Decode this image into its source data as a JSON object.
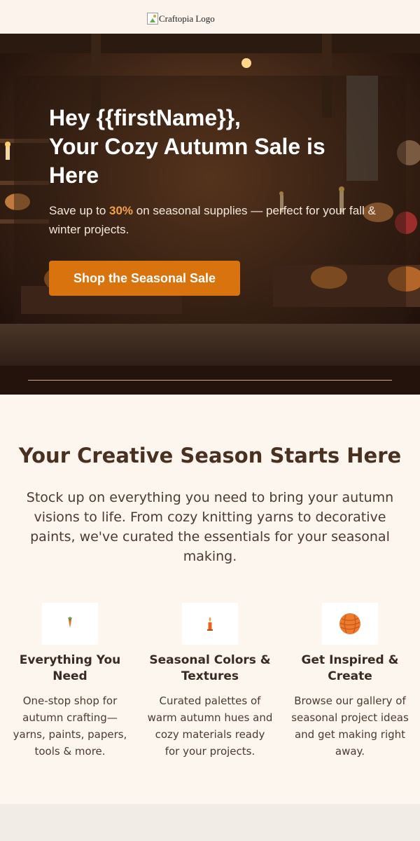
{
  "header": {
    "logo_alt": "Craftopia Logo"
  },
  "hero": {
    "title_line1": "Hey {{firstName}},",
    "title_line2": "Your Cozy Autumn Sale is Here",
    "sub_before": "Save up to ",
    "sub_percent": "30%",
    "sub_after": " on seasonal supplies — perfect for your fall & winter projects.",
    "cta_label": "Shop the Seasonal Sale"
  },
  "intro": {
    "title": "Your Creative Season Starts Here",
    "description": "Stock up on everything you need to bring your autumn visions to life. From cozy knitting yarns to decorative paints, we've curated the essentials for your seasonal making."
  },
  "features": [
    {
      "icon": "carrot-icon",
      "title": "Everything You Need",
      "text": "One-stop shop for autumn crafting—yarns, paints, papers, tools & more."
    },
    {
      "icon": "candle-icon",
      "title": "Seasonal Colors & Textures",
      "text": "Curated palettes of warm autumn hues and cozy materials ready for your projects."
    },
    {
      "icon": "yarn-ball-icon",
      "title": "Get Inspired & Create",
      "text": "Browse our gallery of seasonal project ideas and get making right away."
    }
  ],
  "colors": {
    "accent": "#d9730d",
    "highlight": "#f5a04a",
    "cream": "#fdf6ee",
    "dark_brown": "#2a1610"
  }
}
